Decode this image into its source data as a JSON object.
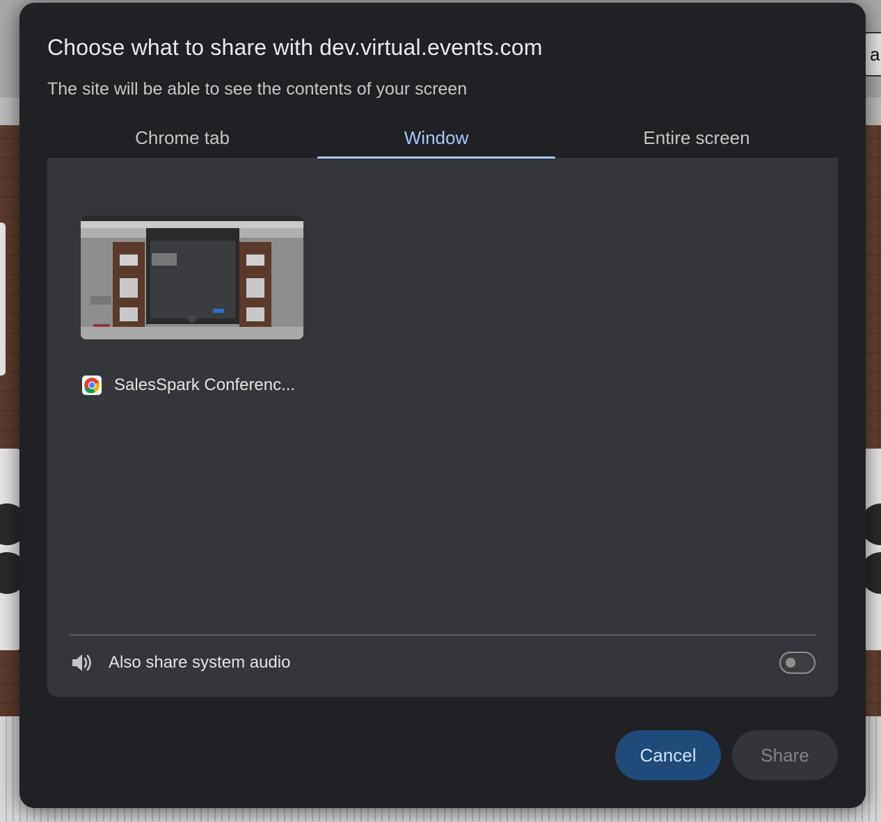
{
  "background": {
    "tab_fragment": "a"
  },
  "dialog": {
    "title": "Choose what to share with dev.virtual.events.com",
    "subtitle": "The site will be able to see the contents of your screen",
    "tabs": [
      {
        "label": "Chrome tab",
        "selected": false
      },
      {
        "label": "Window",
        "selected": true
      },
      {
        "label": "Entire screen",
        "selected": false
      }
    ],
    "windows": [
      {
        "title": "SalesSpark Conferenc...",
        "icon": "chrome-icon"
      }
    ],
    "audio": {
      "label": "Also share system audio",
      "icon": "speaker-icon",
      "enabled": false
    },
    "buttons": {
      "cancel": "Cancel",
      "share": "Share",
      "share_enabled": false
    }
  },
  "colors": {
    "dialog_bg": "#202124",
    "panel_bg": "#35363b",
    "accent": "#a8c7fa",
    "cancel_bg": "#1f4a7a",
    "cancel_text": "#d3e3fd",
    "share_bg": "#333538",
    "share_text": "#808285"
  }
}
